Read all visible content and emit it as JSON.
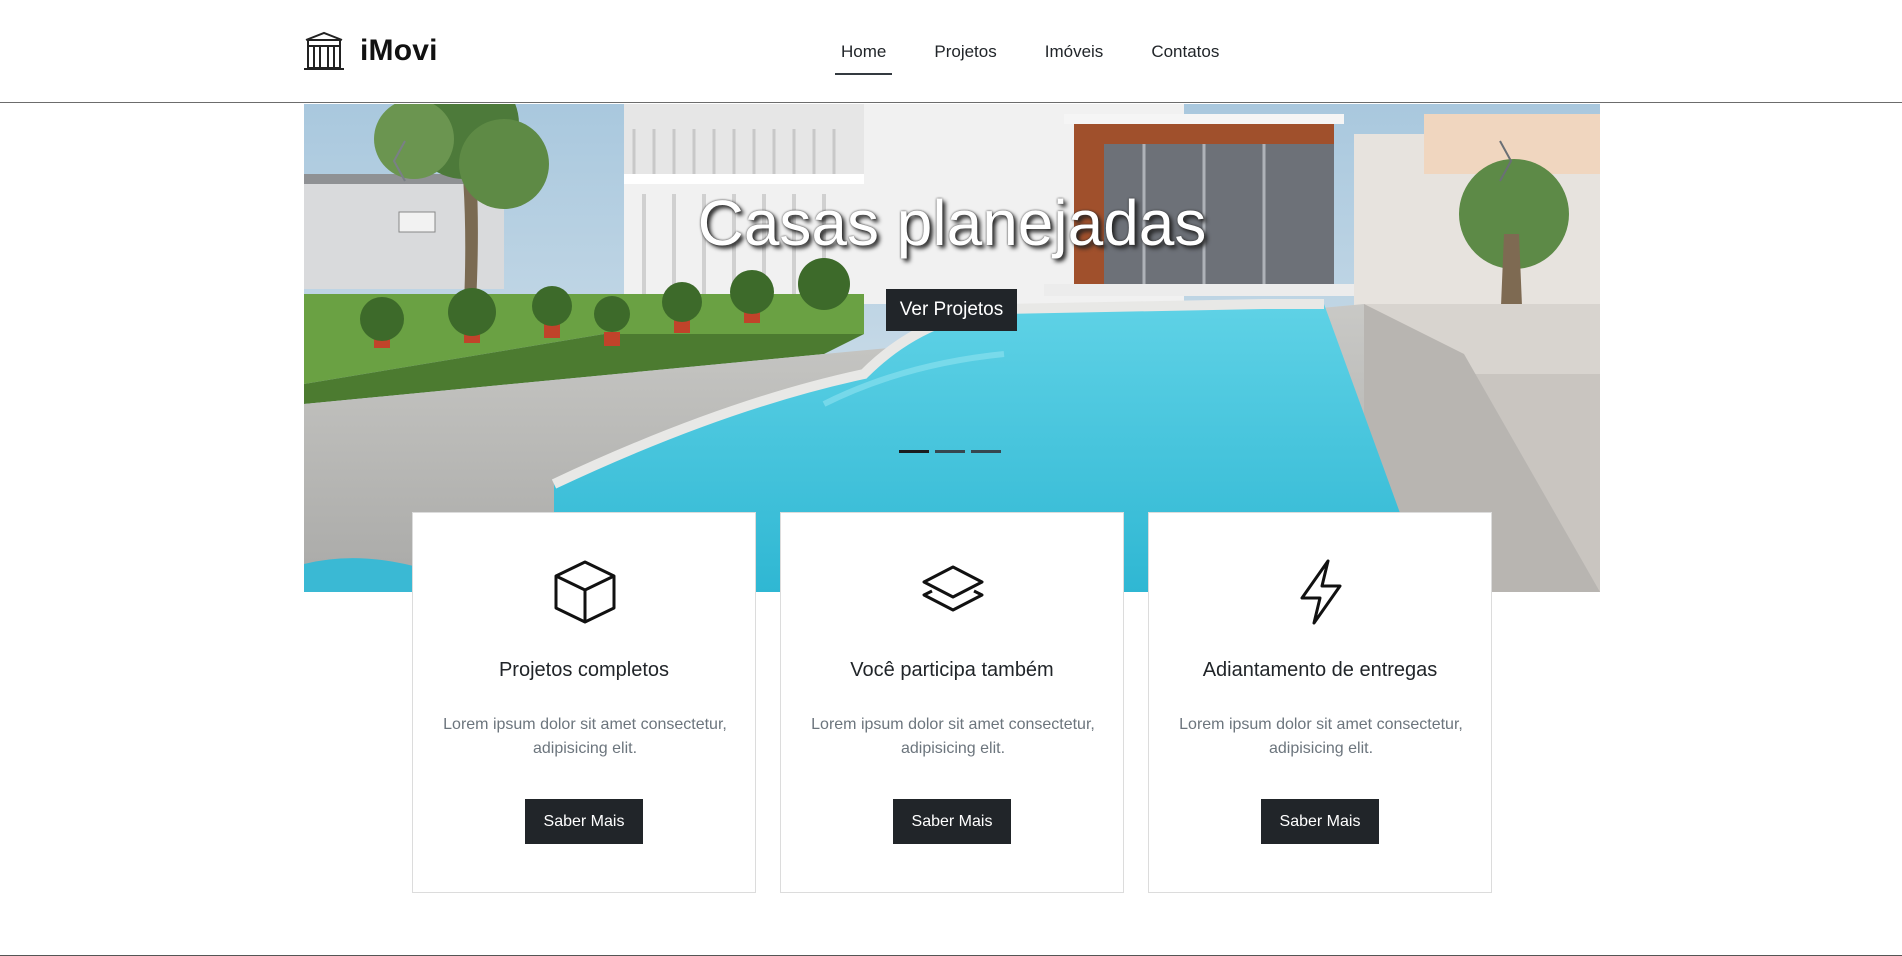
{
  "brand": {
    "name": "iMovi",
    "icon": "building-icon"
  },
  "nav": {
    "items": [
      {
        "label": "Home",
        "active": true
      },
      {
        "label": "Projetos",
        "active": false
      },
      {
        "label": "Imóveis",
        "active": false
      },
      {
        "label": "Contatos",
        "active": false
      }
    ]
  },
  "hero": {
    "title": "Casas planejadas",
    "button_label": "Ver Projetos",
    "slide_count": 3,
    "active_slide": 1,
    "prev_icon": "chevron-left-icon",
    "next_icon": "chevron-right-icon"
  },
  "cards": [
    {
      "icon": "box-icon",
      "title": "Projetos completos",
      "text": "Lorem ipsum dolor sit amet consectetur, adipisicing elit.",
      "button_label": "Saber Mais"
    },
    {
      "icon": "layers-icon",
      "title": "Você participa também",
      "text": "Lorem ipsum dolor sit amet consectetur, adipisicing elit.",
      "button_label": "Saber Mais"
    },
    {
      "icon": "lightning-icon",
      "title": "Adiantamento de entregas",
      "text": "Lorem ipsum dolor sit amet consectetur, adipisicing elit.",
      "button_label": "Saber Mais"
    }
  ],
  "colors": {
    "primary_button": "#212529",
    "card_text": "#6c757d",
    "pool": "#3fc3dc"
  }
}
